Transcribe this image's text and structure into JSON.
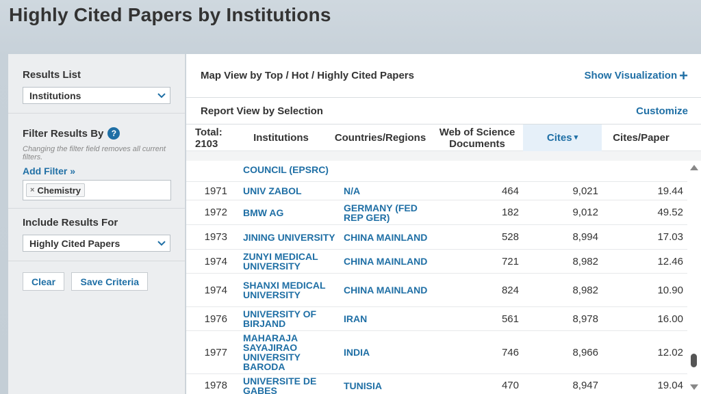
{
  "page": {
    "title": "Highly Cited Papers by Institutions"
  },
  "sidebar": {
    "results_list": {
      "label": "Results List",
      "value": "Institutions"
    },
    "filter": {
      "label": "Filter Results By",
      "help_icon": "?",
      "note": "Changing the filter field removes all current filters.",
      "add_filter": "Add Filter »",
      "chips": [
        {
          "remove": "×",
          "label": "Chemistry"
        }
      ]
    },
    "include": {
      "label": "Include Results For",
      "value": "Highly Cited Papers"
    },
    "buttons": {
      "clear": "Clear",
      "save": "Save Criteria"
    }
  },
  "main": {
    "map_view": {
      "title": "Map View by Top / Hot / Highly Cited Papers",
      "link": "Show Visualization",
      "link_icon": "+"
    },
    "report_view": {
      "title": "Report View by Selection",
      "link": "Customize"
    },
    "table": {
      "total_label": "Total:",
      "total_value": "2103",
      "columns": {
        "institutions": "Institutions",
        "countries": "Countries/Regions",
        "docs": "Web of Science Documents",
        "cites": "Cites",
        "cites_sort_icon": "▾",
        "cpp": "Cites/Paper"
      },
      "rows": [
        {
          "rank": "",
          "institution": "COUNCIL (EPSRC)",
          "country": "",
          "docs": "",
          "cites": "",
          "cpp": ""
        },
        {
          "rank": "1971",
          "institution": "UNIV ZABOL",
          "country": "N/A",
          "docs": "464",
          "cites": "9,021",
          "cpp": "19.44"
        },
        {
          "rank": "1972",
          "institution": "BMW AG",
          "country": "GERMANY (FED REP GER)",
          "docs": "182",
          "cites": "9,012",
          "cpp": "49.52"
        },
        {
          "rank": "1973",
          "institution": "JINING UNIVERSITY",
          "country": "CHINA MAINLAND",
          "docs": "528",
          "cites": "8,994",
          "cpp": "17.03"
        },
        {
          "rank": "1974",
          "institution": "ZUNYI MEDICAL UNIVERSITY",
          "country": "CHINA MAINLAND",
          "docs": "721",
          "cites": "8,982",
          "cpp": "12.46"
        },
        {
          "rank": "1974",
          "institution": "SHANXI MEDICAL UNIVERSITY",
          "country": "CHINA MAINLAND",
          "docs": "824",
          "cites": "8,982",
          "cpp": "10.90"
        },
        {
          "rank": "1976",
          "institution": "UNIVERSITY OF BIRJAND",
          "country": "IRAN",
          "docs": "561",
          "cites": "8,978",
          "cpp": "16.00"
        },
        {
          "rank": "1977",
          "institution": "MAHARAJA SAYAJIRAO UNIVERSITY BARODA",
          "country": "INDIA",
          "docs": "746",
          "cites": "8,966",
          "cpp": "12.02"
        },
        {
          "rank": "1978",
          "institution": "UNIVERSITE DE GABES",
          "country": "TUNISIA",
          "docs": "470",
          "cites": "8,947",
          "cpp": "19.04"
        }
      ]
    }
  }
}
